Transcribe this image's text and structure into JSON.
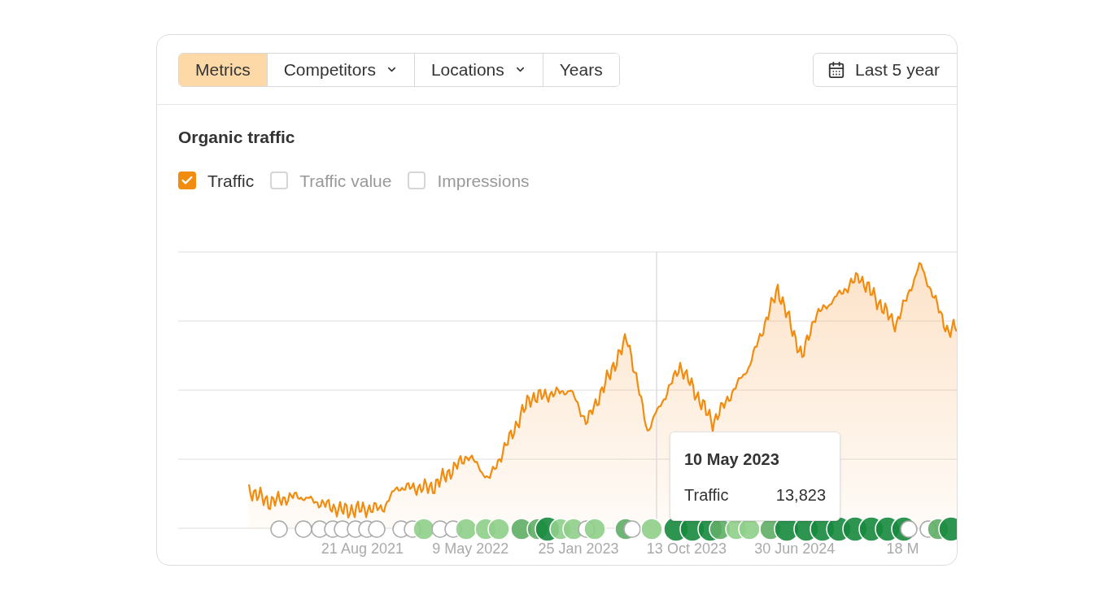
{
  "toolbar": {
    "tabs": [
      {
        "label": "Metrics",
        "selected": true,
        "dropdown": false
      },
      {
        "label": "Competitors",
        "selected": false,
        "dropdown": true
      },
      {
        "label": "Locations",
        "selected": false,
        "dropdown": true
      },
      {
        "label": "Years",
        "selected": false,
        "dropdown": false
      }
    ],
    "date_range": {
      "label": "Last 5 year"
    }
  },
  "chart": {
    "title": "Organic traffic",
    "legend": [
      {
        "label": "Traffic",
        "checked": true
      },
      {
        "label": "Traffic value",
        "checked": false
      },
      {
        "label": "Impressions",
        "checked": false
      }
    ],
    "x_axis_labels": [
      "21 Aug 2021",
      "9 May 2022",
      "25 Jan 2023",
      "13 Oct 2023",
      "30 Jun 2024",
      "18 M"
    ],
    "tooltip": {
      "date": "10 May 2023",
      "rows": [
        {
          "label": "Traffic",
          "value": "13,823"
        }
      ]
    }
  }
}
